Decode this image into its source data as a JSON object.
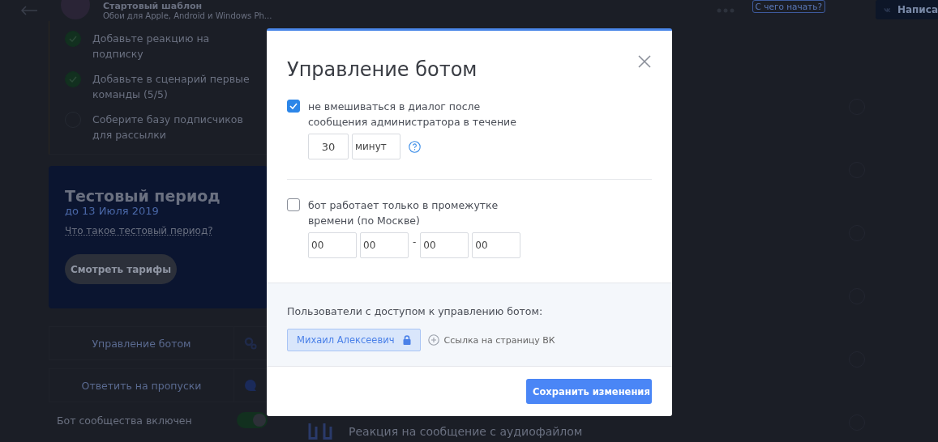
{
  "header": {
    "title": "Стартовый шаблон",
    "subtitle": "Обои для Apple, Android и Windows Ph...",
    "help_button": "С чего начать?",
    "vk_button": "Написа"
  },
  "checklist": [
    {
      "label": "Добавьте реакцию на подписку",
      "done": true
    },
    {
      "label": "Добавьте в сценарий первые команды (5/5)",
      "done": true
    },
    {
      "label": "Соберите базу подписчиков для рассылки",
      "done": false
    }
  ],
  "trial": {
    "title": "Тестовый период",
    "date": "до 13 Июля 2019",
    "link": "Что такое тестовый период?",
    "button": "Смотреть тарифы"
  },
  "menu": [
    {
      "label": "Управление ботом",
      "kind": "settings"
    },
    {
      "label": "Ответить на пропуски",
      "kind": "chat"
    }
  ],
  "bot_toggle": {
    "label": "Бот сообщества включен",
    "on": true
  },
  "background_rows": [
    {
      "text": "Реакция на сообщение с аудиофайлом"
    }
  ],
  "modal": {
    "title": "Управление ботом",
    "options": [
      {
        "kind": "timeout",
        "label": "не вмешиваться в диалог после сообщения администратора в течение",
        "checked": true,
        "value": "30",
        "unit": "минут"
      },
      {
        "kind": "schedule",
        "label": "бот работает только в промежутке времени (по Москве)",
        "checked": false,
        "from_hours": "00",
        "from_minutes": "00",
        "separator": "-",
        "to_hours": "00",
        "to_minutes": "00"
      }
    ],
    "access": {
      "label": "Пользователи с доступом к управлению ботом:",
      "users": [
        {
          "name": "Михаил Алексеевич",
          "locked": true
        }
      ],
      "add_link": "Ссылка на страницу ВК"
    },
    "save_button": "Сохранить изменения"
  }
}
